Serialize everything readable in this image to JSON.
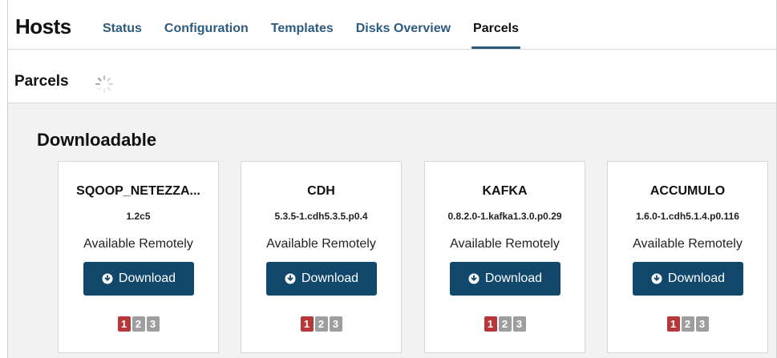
{
  "header": {
    "title": "Hosts",
    "tabs": [
      {
        "label": "Status",
        "active": false
      },
      {
        "label": "Configuration",
        "active": false
      },
      {
        "label": "Templates",
        "active": false
      },
      {
        "label": "Disks Overview",
        "active": false
      },
      {
        "label": "Parcels",
        "active": true
      }
    ]
  },
  "section": {
    "title": "Parcels",
    "loading_icon": "spinner-icon"
  },
  "group": {
    "title": "Downloadable"
  },
  "colors": {
    "button": "#10476b",
    "step_active": "#b6383b",
    "step_inactive": "#9e9e9e",
    "tab_link": "#2d5b80"
  },
  "parcels": [
    {
      "name": "SQOOP_NETEZZA...",
      "version": "1.2c5",
      "status": "Available Remotely",
      "button_label": "Download",
      "steps": [
        "1",
        "2",
        "3"
      ]
    },
    {
      "name": "CDH",
      "version": "5.3.5-1.cdh5.3.5.p0.4",
      "status": "Available Remotely",
      "button_label": "Download",
      "steps": [
        "1",
        "2",
        "3"
      ]
    },
    {
      "name": "KAFKA",
      "version": "0.8.2.0-1.kafka1.3.0.p0.29",
      "status": "Available Remotely",
      "button_label": "Download",
      "steps": [
        "1",
        "2",
        "3"
      ]
    },
    {
      "name": "ACCUMULO",
      "version": "1.6.0-1.cdh5.1.4.p0.116",
      "status": "Available Remotely",
      "button_label": "Download",
      "steps": [
        "1",
        "2",
        "3"
      ]
    }
  ]
}
